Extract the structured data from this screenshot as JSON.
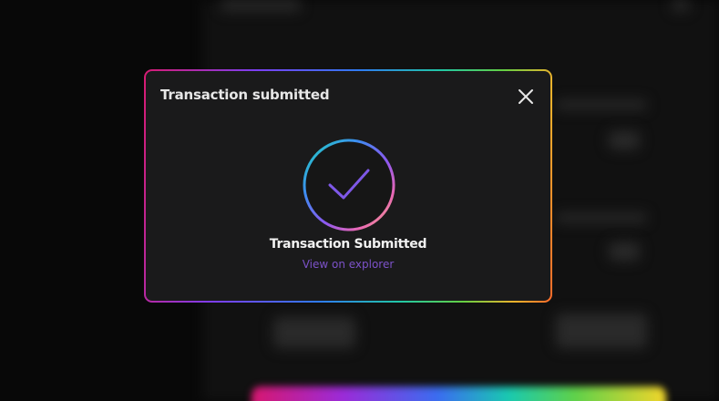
{
  "modal": {
    "title": "Transaction submitted",
    "status_text": "Transaction Submitted",
    "explorer_link_label": "View on explorer"
  },
  "icons": {
    "close": "close-icon",
    "success": "checkmark-circle-icon"
  },
  "colors": {
    "page_background": "#080808",
    "modal_background": "#1a1a1b",
    "link": "#7c52c9",
    "check": "#7e58e7",
    "title_text": "#e7e7e7"
  }
}
